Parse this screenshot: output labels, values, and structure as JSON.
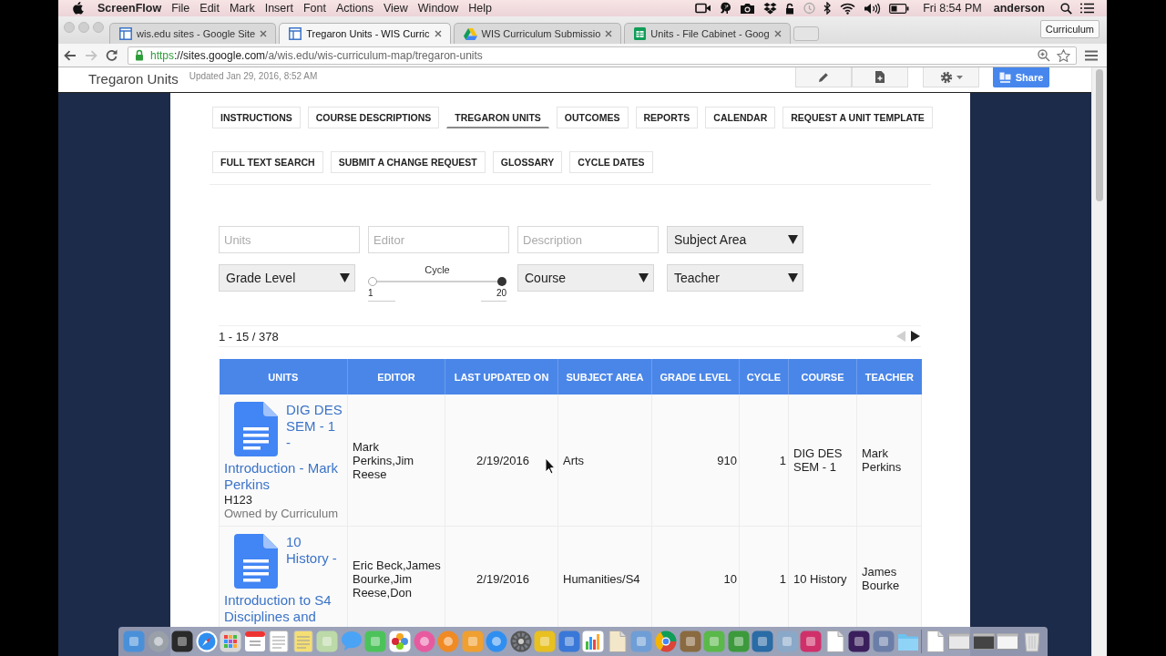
{
  "menubar": {
    "app": "ScreenFlow",
    "menus": [
      "File",
      "Edit",
      "Mark",
      "Insert",
      "Font",
      "Actions",
      "View",
      "Window",
      "Help"
    ],
    "clock": "Fri 8:54 PM",
    "user": "anderson"
  },
  "browser": {
    "tabs": [
      {
        "title": "wis.edu sites - Google Site",
        "kind": "sites",
        "selected": false
      },
      {
        "title": "Tregaron Units - WIS Curric",
        "kind": "sites",
        "selected": true
      },
      {
        "title": "WIS Curriculum Submissio",
        "kind": "drive",
        "selected": false
      },
      {
        "title": "Units - File Cabinet - Goog",
        "kind": "sheets",
        "selected": false
      }
    ],
    "profile": "Curriculum",
    "url_parts": [
      "https",
      "://sites.google.com",
      "/a/wis.edu/wis-curriculum-map/tregaron-units"
    ]
  },
  "site_header": {
    "title": "Tregaron Units",
    "updated": "Updated Jan 29, 2016, 8:52 AM",
    "share": "Share"
  },
  "nav_rows": [
    [
      {
        "label": "INSTRUCTIONS",
        "selected": false
      },
      {
        "label": "COURSE DESCRIPTIONS",
        "selected": false
      },
      {
        "label": "TREGARON UNITS",
        "selected": true
      },
      {
        "label": "OUTCOMES",
        "selected": false
      },
      {
        "label": "REPORTS",
        "selected": false
      },
      {
        "label": "CALENDAR",
        "selected": false
      },
      {
        "label": "REQUEST A UNIT TEMPLATE",
        "selected": false
      }
    ],
    [
      {
        "label": "FULL TEXT SEARCH",
        "selected": false
      },
      {
        "label": "SUBMIT A CHANGE REQUEST",
        "selected": false
      },
      {
        "label": "GLOSSARY",
        "selected": false
      },
      {
        "label": "CYCLE DATES",
        "selected": false
      }
    ]
  ],
  "filters": [
    {
      "kind": "text",
      "placeholder": "Units"
    },
    {
      "kind": "text",
      "placeholder": "Editor"
    },
    {
      "kind": "text",
      "placeholder": "Description"
    },
    {
      "kind": "select",
      "label": "Subject Area"
    },
    {
      "kind": "select",
      "label": "Grade Level"
    },
    {
      "kind": "range",
      "label": "Cycle",
      "min": "1",
      "max": "20",
      "thumbs": [
        {
          "level": 0
        },
        {
          "level": 1
        }
      ]
    },
    {
      "kind": "select",
      "label": "Course"
    },
    {
      "kind": "select",
      "label": "Teacher"
    }
  ],
  "pager": {
    "range": "1 - 15 / 378",
    "prev_disabled": true,
    "next_disabled": false
  },
  "table": {
    "columns": [
      "UNITS",
      "EDITOR",
      "LAST UPDATED ON",
      "SUBJECT AREA",
      "GRADE LEVEL",
      "CYCLE",
      "COURSE",
      "TEACHER"
    ],
    "rows": [
      {
        "cells": [
          {
            "title": "DIG DES SEM - 1 - Introduction - Mark Perkins",
            "code": "H123",
            "owner": "Owned by Curriculum"
          },
          "Mark Perkins,Jim Reese",
          "2/19/2016",
          "Arts",
          "910",
          "1",
          "DIG DES SEM - 1",
          "Mark Perkins"
        ]
      },
      {
        "cells": [
          {
            "title": "10 History - Introduction to S4 Disciplines and"
          },
          "Eric Beck,James Bourke,Jim Reese,Don",
          "2/19/2016",
          "Humanities/S4",
          "10",
          "1",
          "10 History",
          "James Bourke"
        ]
      }
    ]
  }
}
